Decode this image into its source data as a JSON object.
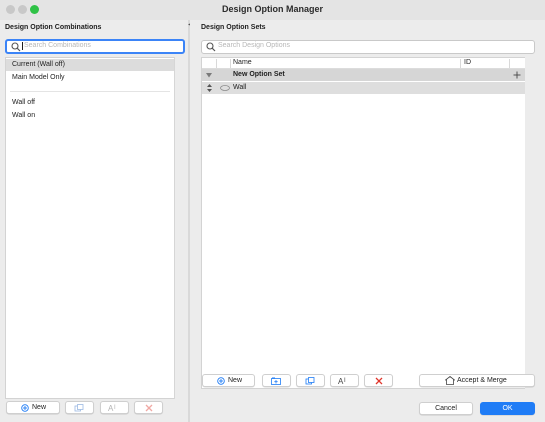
{
  "window": {
    "title": "Design Option Manager",
    "traffic_lights": {
      "close": "#c8c8c8",
      "minimize": "#c8c8c8",
      "zoom": "#2fc246"
    }
  },
  "left": {
    "heading": "Design Option Combinations",
    "search_placeholder": "Search Combinations",
    "items": [
      {
        "label": "Current (Wall off)",
        "selected": true
      },
      {
        "label": "Main Model Only",
        "selected": false
      },
      {
        "label": "Wall off",
        "selected": false
      },
      {
        "label": "Wall on",
        "selected": false
      }
    ],
    "toolbar": {
      "new_label": "New"
    }
  },
  "right": {
    "heading": "Design Option Sets",
    "search_placeholder": "Search Design Options",
    "table": {
      "columns": {
        "name": "Name",
        "id": "ID"
      },
      "group_row": {
        "label": "New Option Set"
      },
      "rows": [
        {
          "label": "Wall"
        }
      ]
    },
    "toolbar": {
      "new_label": "New",
      "accept_merge_label": "Accept & Merge"
    },
    "footer": {
      "cancel_label": "Cancel",
      "ok_label": "OK"
    }
  },
  "icons": {
    "search": "search-icon",
    "add": "plus-circle-icon",
    "duplicate": "duplicate-icon",
    "rename": "rename-icon",
    "delete": "delete-x-icon",
    "add_set": "add-set-icon",
    "folder": "folder-icon",
    "expand": "triangle-down-icon",
    "reorder": "up-down-arrows-icon",
    "visibility": "eye-icon",
    "accept": "house-icon"
  },
  "colors": {
    "accent": "#1f7cf6",
    "delete": "#e0362c",
    "focus_ring": "#3b84f7"
  }
}
